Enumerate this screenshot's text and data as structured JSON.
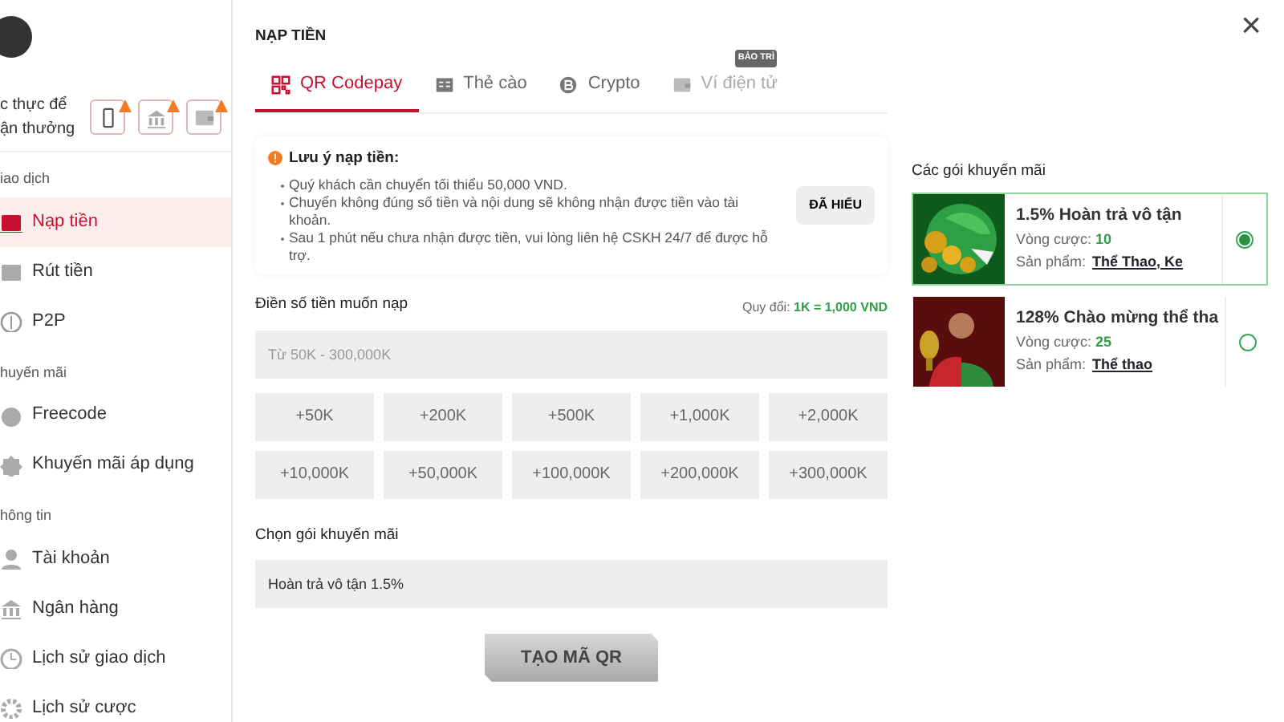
{
  "sidebar": {
    "verify_lines": [
      "c thực để",
      "ận thưởng"
    ],
    "sections": [
      {
        "title": "iao dịch",
        "items": [
          {
            "label": "Nạp tiền",
            "selected": true
          },
          {
            "label": "Rút tiền",
            "selected": false
          },
          {
            "label": "P2P",
            "selected": false
          }
        ]
      },
      {
        "title": "huyến mãi",
        "items": [
          {
            "label": "Freecode",
            "selected": false
          },
          {
            "label": "Khuyến mãi áp dụng",
            "selected": false
          }
        ]
      },
      {
        "title": "hông tin",
        "items": [
          {
            "label": "Tài khoản",
            "selected": false
          },
          {
            "label": "Ngân hàng",
            "selected": false
          },
          {
            "label": "Lịch sử giao dịch",
            "selected": false
          },
          {
            "label": "Lịch sử cược",
            "selected": false
          }
        ]
      }
    ]
  },
  "page_title": "NẠP TIỀN",
  "tabs": [
    {
      "label": "QR Codepay",
      "selected": true,
      "disabled": false
    },
    {
      "label": "Thẻ cào",
      "selected": false,
      "disabled": false
    },
    {
      "label": "Crypto",
      "selected": false,
      "disabled": false
    },
    {
      "label": "Ví điện tử",
      "selected": false,
      "disabled": true,
      "badge": "BẢO TRÌ"
    }
  ],
  "notice": {
    "title": "Lưu ý nạp tiền:",
    "lines": [
      "Quý khách cần chuyển tối thiểu 50,000 VND.",
      "Chuyển không đúng số tiền và nội dung sẽ không nhận được tiền vào tài khoản.",
      "Sau 1 phút nếu chưa nhận được tiền, vui lòng liên hệ CSKH 24/7 để được hỗ trợ."
    ],
    "button": "ĐÃ HIỂU"
  },
  "amount": {
    "label": "Điền số tiền muốn nạp",
    "rate_label": "Quy đổi:",
    "rate_value": "1K = 1,000 VND",
    "placeholder": "Từ 50K - 300,000K"
  },
  "quick_amounts": [
    "+50K",
    "+200K",
    "+500K",
    "+1,000K",
    "+2,000K",
    "+10,000K",
    "+50,000K",
    "+100,000K",
    "+200,000K",
    "+300,000K"
  ],
  "promo_select": {
    "label": "Chọn gói khuyến mãi",
    "value": "Hoàn trả vô tận 1.5%"
  },
  "submit": "TẠO MÃ QR",
  "promos_title": "Các gói khuyến mãi",
  "promos": [
    {
      "title": "1.5% Hoàn trả vô tận",
      "rounds_label": "Vòng cược:",
      "rounds": "10",
      "product_label": "Sản phẩm:",
      "product": "Thể Thao, Ke",
      "selected": true
    },
    {
      "title": "128% Chào mừng thể tha",
      "rounds_label": "Vòng cược:",
      "rounds": "25",
      "product_label": "Sản phẩm:",
      "product": "Thể thao",
      "selected": false
    }
  ],
  "close": "×"
}
